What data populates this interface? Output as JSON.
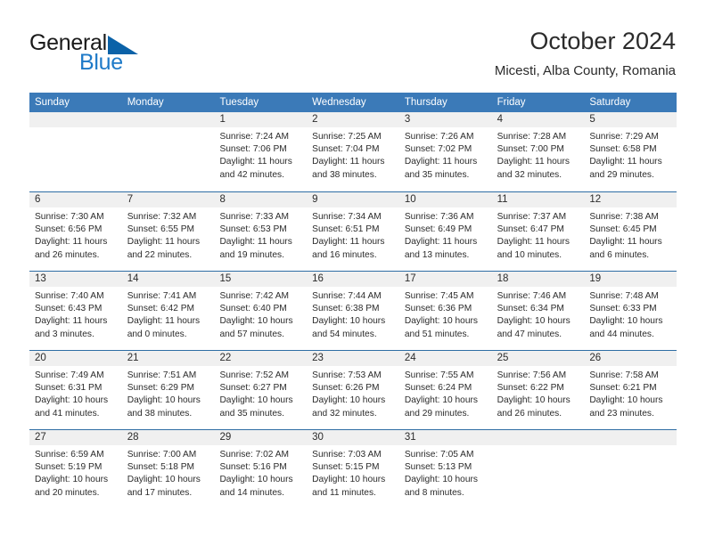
{
  "brand": {
    "name_part1": "General",
    "name_part2": "Blue",
    "accent_color": "#1e7ac8",
    "triangle_icon": "triangle-icon"
  },
  "header": {
    "title": "October 2024",
    "subtitle": "Micesti, Alba County, Romania"
  },
  "calendar": {
    "header_color": "#3b7ab8",
    "row_border_color": "#2e6da4",
    "daynum_band_color": "#f0f0f0",
    "weekdays": [
      "Sunday",
      "Monday",
      "Tuesday",
      "Wednesday",
      "Thursday",
      "Friday",
      "Saturday"
    ],
    "weeks": [
      [
        {
          "day": "",
          "sunrise": "",
          "sunset": "",
          "daylight_line1": "",
          "daylight_line2": ""
        },
        {
          "day": "",
          "sunrise": "",
          "sunset": "",
          "daylight_line1": "",
          "daylight_line2": ""
        },
        {
          "day": "1",
          "sunrise": "Sunrise: 7:24 AM",
          "sunset": "Sunset: 7:06 PM",
          "daylight_line1": "Daylight: 11 hours",
          "daylight_line2": "and 42 minutes."
        },
        {
          "day": "2",
          "sunrise": "Sunrise: 7:25 AM",
          "sunset": "Sunset: 7:04 PM",
          "daylight_line1": "Daylight: 11 hours",
          "daylight_line2": "and 38 minutes."
        },
        {
          "day": "3",
          "sunrise": "Sunrise: 7:26 AM",
          "sunset": "Sunset: 7:02 PM",
          "daylight_line1": "Daylight: 11 hours",
          "daylight_line2": "and 35 minutes."
        },
        {
          "day": "4",
          "sunrise": "Sunrise: 7:28 AM",
          "sunset": "Sunset: 7:00 PM",
          "daylight_line1": "Daylight: 11 hours",
          "daylight_line2": "and 32 minutes."
        },
        {
          "day": "5",
          "sunrise": "Sunrise: 7:29 AM",
          "sunset": "Sunset: 6:58 PM",
          "daylight_line1": "Daylight: 11 hours",
          "daylight_line2": "and 29 minutes."
        }
      ],
      [
        {
          "day": "6",
          "sunrise": "Sunrise: 7:30 AM",
          "sunset": "Sunset: 6:56 PM",
          "daylight_line1": "Daylight: 11 hours",
          "daylight_line2": "and 26 minutes."
        },
        {
          "day": "7",
          "sunrise": "Sunrise: 7:32 AM",
          "sunset": "Sunset: 6:55 PM",
          "daylight_line1": "Daylight: 11 hours",
          "daylight_line2": "and 22 minutes."
        },
        {
          "day": "8",
          "sunrise": "Sunrise: 7:33 AM",
          "sunset": "Sunset: 6:53 PM",
          "daylight_line1": "Daylight: 11 hours",
          "daylight_line2": "and 19 minutes."
        },
        {
          "day": "9",
          "sunrise": "Sunrise: 7:34 AM",
          "sunset": "Sunset: 6:51 PM",
          "daylight_line1": "Daylight: 11 hours",
          "daylight_line2": "and 16 minutes."
        },
        {
          "day": "10",
          "sunrise": "Sunrise: 7:36 AM",
          "sunset": "Sunset: 6:49 PM",
          "daylight_line1": "Daylight: 11 hours",
          "daylight_line2": "and 13 minutes."
        },
        {
          "day": "11",
          "sunrise": "Sunrise: 7:37 AM",
          "sunset": "Sunset: 6:47 PM",
          "daylight_line1": "Daylight: 11 hours",
          "daylight_line2": "and 10 minutes."
        },
        {
          "day": "12",
          "sunrise": "Sunrise: 7:38 AM",
          "sunset": "Sunset: 6:45 PM",
          "daylight_line1": "Daylight: 11 hours",
          "daylight_line2": "and 6 minutes."
        }
      ],
      [
        {
          "day": "13",
          "sunrise": "Sunrise: 7:40 AM",
          "sunset": "Sunset: 6:43 PM",
          "daylight_line1": "Daylight: 11 hours",
          "daylight_line2": "and 3 minutes."
        },
        {
          "day": "14",
          "sunrise": "Sunrise: 7:41 AM",
          "sunset": "Sunset: 6:42 PM",
          "daylight_line1": "Daylight: 11 hours",
          "daylight_line2": "and 0 minutes."
        },
        {
          "day": "15",
          "sunrise": "Sunrise: 7:42 AM",
          "sunset": "Sunset: 6:40 PM",
          "daylight_line1": "Daylight: 10 hours",
          "daylight_line2": "and 57 minutes."
        },
        {
          "day": "16",
          "sunrise": "Sunrise: 7:44 AM",
          "sunset": "Sunset: 6:38 PM",
          "daylight_line1": "Daylight: 10 hours",
          "daylight_line2": "and 54 minutes."
        },
        {
          "day": "17",
          "sunrise": "Sunrise: 7:45 AM",
          "sunset": "Sunset: 6:36 PM",
          "daylight_line1": "Daylight: 10 hours",
          "daylight_line2": "and 51 minutes."
        },
        {
          "day": "18",
          "sunrise": "Sunrise: 7:46 AM",
          "sunset": "Sunset: 6:34 PM",
          "daylight_line1": "Daylight: 10 hours",
          "daylight_line2": "and 47 minutes."
        },
        {
          "day": "19",
          "sunrise": "Sunrise: 7:48 AM",
          "sunset": "Sunset: 6:33 PM",
          "daylight_line1": "Daylight: 10 hours",
          "daylight_line2": "and 44 minutes."
        }
      ],
      [
        {
          "day": "20",
          "sunrise": "Sunrise: 7:49 AM",
          "sunset": "Sunset: 6:31 PM",
          "daylight_line1": "Daylight: 10 hours",
          "daylight_line2": "and 41 minutes."
        },
        {
          "day": "21",
          "sunrise": "Sunrise: 7:51 AM",
          "sunset": "Sunset: 6:29 PM",
          "daylight_line1": "Daylight: 10 hours",
          "daylight_line2": "and 38 minutes."
        },
        {
          "day": "22",
          "sunrise": "Sunrise: 7:52 AM",
          "sunset": "Sunset: 6:27 PM",
          "daylight_line1": "Daylight: 10 hours",
          "daylight_line2": "and 35 minutes."
        },
        {
          "day": "23",
          "sunrise": "Sunrise: 7:53 AM",
          "sunset": "Sunset: 6:26 PM",
          "daylight_line1": "Daylight: 10 hours",
          "daylight_line2": "and 32 minutes."
        },
        {
          "day": "24",
          "sunrise": "Sunrise: 7:55 AM",
          "sunset": "Sunset: 6:24 PM",
          "daylight_line1": "Daylight: 10 hours",
          "daylight_line2": "and 29 minutes."
        },
        {
          "day": "25",
          "sunrise": "Sunrise: 7:56 AM",
          "sunset": "Sunset: 6:22 PM",
          "daylight_line1": "Daylight: 10 hours",
          "daylight_line2": "and 26 minutes."
        },
        {
          "day": "26",
          "sunrise": "Sunrise: 7:58 AM",
          "sunset": "Sunset: 6:21 PM",
          "daylight_line1": "Daylight: 10 hours",
          "daylight_line2": "and 23 minutes."
        }
      ],
      [
        {
          "day": "27",
          "sunrise": "Sunrise: 6:59 AM",
          "sunset": "Sunset: 5:19 PM",
          "daylight_line1": "Daylight: 10 hours",
          "daylight_line2": "and 20 minutes."
        },
        {
          "day": "28",
          "sunrise": "Sunrise: 7:00 AM",
          "sunset": "Sunset: 5:18 PM",
          "daylight_line1": "Daylight: 10 hours",
          "daylight_line2": "and 17 minutes."
        },
        {
          "day": "29",
          "sunrise": "Sunrise: 7:02 AM",
          "sunset": "Sunset: 5:16 PM",
          "daylight_line1": "Daylight: 10 hours",
          "daylight_line2": "and 14 minutes."
        },
        {
          "day": "30",
          "sunrise": "Sunrise: 7:03 AM",
          "sunset": "Sunset: 5:15 PM",
          "daylight_line1": "Daylight: 10 hours",
          "daylight_line2": "and 11 minutes."
        },
        {
          "day": "31",
          "sunrise": "Sunrise: 7:05 AM",
          "sunset": "Sunset: 5:13 PM",
          "daylight_line1": "Daylight: 10 hours",
          "daylight_line2": "and 8 minutes."
        },
        {
          "day": "",
          "sunrise": "",
          "sunset": "",
          "daylight_line1": "",
          "daylight_line2": ""
        },
        {
          "day": "",
          "sunrise": "",
          "sunset": "",
          "daylight_line1": "",
          "daylight_line2": ""
        }
      ]
    ]
  }
}
